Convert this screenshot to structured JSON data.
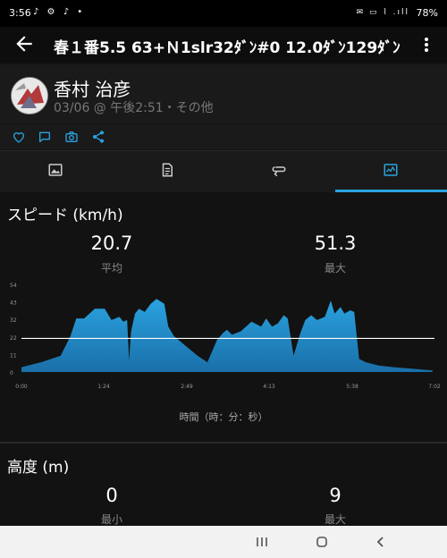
{
  "status_bar": {
    "time": "3:56",
    "left_icons": "♪ ⚙ ♪ •",
    "right_icons": "✉ ▭ ⌇ .ıll",
    "battery": "78%"
  },
  "header": {
    "title": "春１番5.5 63+Ｎ1slr32ﾀﾞﾝ#0 12.0ﾀﾞﾝ129ﾀﾞﾝ"
  },
  "profile": {
    "name": "香村 治彦",
    "time": "03/06 @ 午後2:51・その他"
  },
  "actions": [
    "heart-icon",
    "comment-icon",
    "camera-icon",
    "share-icon"
  ],
  "tabs": [
    {
      "icon": "image-icon"
    },
    {
      "icon": "document-icon"
    },
    {
      "icon": "loop-icon"
    },
    {
      "icon": "chart-icon",
      "active": true
    }
  ],
  "speed": {
    "title": "スピード (km/h)",
    "avg_value": "20.7",
    "avg_label": "平均",
    "max_value": "51.3",
    "max_label": "最大"
  },
  "chart_data": {
    "type": "area",
    "xlabel": "時間（時：分：秒）",
    "ylabel": "",
    "y_ticks": [
      "0",
      "11",
      "22",
      "32",
      "43",
      "54"
    ],
    "ylim": [
      0,
      54
    ],
    "x_ticks": [
      "0:00",
      "1:24",
      "2:49",
      "4:13",
      "5:38",
      "7:02"
    ],
    "x_tick_minutes": [
      0,
      84,
      169,
      253,
      338,
      422
    ],
    "xlim_minutes": [
      0,
      422
    ],
    "average_line": 20.7,
    "fill_color": "#2aa3e0",
    "x_minutes": [
      0,
      20,
      40,
      50,
      56,
      64,
      75,
      85,
      92,
      100,
      104,
      108,
      110,
      112,
      116,
      120,
      126,
      132,
      138,
      146,
      150,
      156,
      162,
      168,
      172,
      180,
      190,
      200,
      206,
      210,
      215,
      224,
      235,
      245,
      250,
      256,
      262,
      268,
      272,
      278,
      285,
      290,
      296,
      302,
      306,
      310,
      316,
      320,
      326,
      330,
      336,
      340,
      345,
      352,
      358,
      365,
      380,
      400,
      420
    ],
    "values": [
      3,
      6,
      10,
      22,
      33,
      33,
      39,
      39,
      32,
      34,
      31,
      32,
      7,
      25,
      36,
      39,
      37,
      42,
      45,
      42,
      28,
      22,
      19,
      16,
      14,
      10,
      6,
      20,
      24,
      26,
      23,
      25,
      31,
      28,
      33,
      28,
      30,
      35,
      33,
      10,
      24,
      32,
      35,
      32,
      33,
      34,
      44,
      36,
      40,
      36,
      38,
      37,
      8,
      6,
      5,
      4,
      3,
      2,
      1
    ]
  },
  "elevation": {
    "title": "高度 (m)",
    "min_value": "0",
    "min_label": "最小",
    "max_value": "9",
    "max_label": "最大"
  },
  "nav": [
    "recents-icon",
    "home-icon",
    "back-nav-icon"
  ]
}
